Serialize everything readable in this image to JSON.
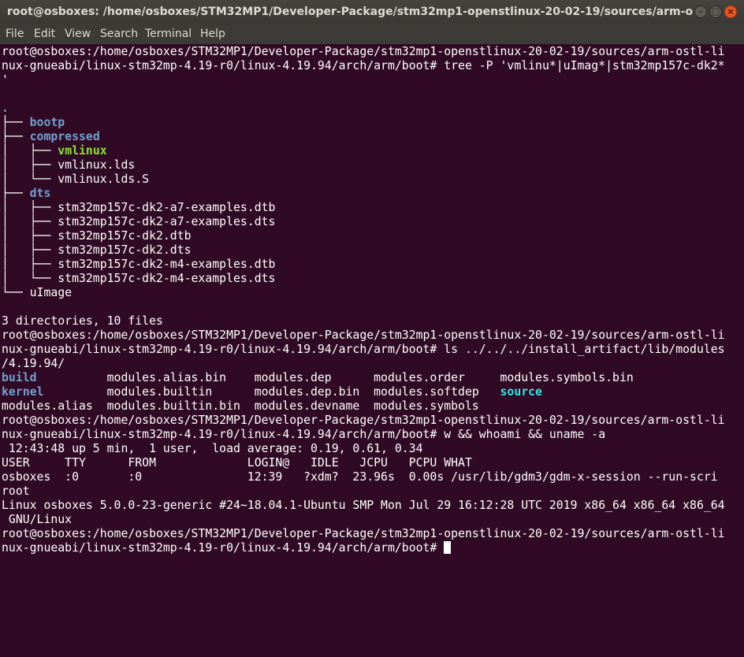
{
  "window": {
    "title": "root@osboxes: /home/osboxes/STM32MP1/Developer-Package/stm32mp1-openstlinux-20-02-19/sources/arm-ostl-linux-...",
    "buttons": {
      "minimize": "–",
      "maximize": "□",
      "close": "×"
    }
  },
  "menu": [
    "File",
    "Edit",
    "View",
    "Search",
    "Terminal",
    "Help"
  ],
  "terminal": {
    "lines": [
      [
        {
          "t": "root@osboxes:/home/osboxes/STM32MP1/Developer-Package/stm32mp1-openstlinux-20-02-19/sources/arm-ostl-li"
        }
      ],
      [
        {
          "t": "nux-gnueabi/linux-stm32mp-4.19-r0/linux-4.19.94/arch/arm/boot# tree -P 'vmlinu*|uImag*|stm32mp157c-dk2*"
        }
      ],
      [
        {
          "t": "'"
        }
      ],
      [
        {
          "t": "",
          "c": ""
        }
      ],
      [
        {
          "t": ".",
          "c": "blue"
        }
      ],
      [
        {
          "t": "├── "
        },
        {
          "t": "bootp",
          "c": "blue"
        }
      ],
      [
        {
          "t": "├── "
        },
        {
          "t": "compressed",
          "c": "blue"
        }
      ],
      [
        {
          "t": "│   ├── "
        },
        {
          "t": "vmlinux",
          "c": "green"
        }
      ],
      [
        {
          "t": "│   ├── vmlinux.lds"
        }
      ],
      [
        {
          "t": "│   └── vmlinux.lds.S"
        }
      ],
      [
        {
          "t": "├── "
        },
        {
          "t": "dts",
          "c": "blue"
        }
      ],
      [
        {
          "t": "│   ├── stm32mp157c-dk2-a7-examples.dtb"
        }
      ],
      [
        {
          "t": "│   ├── stm32mp157c-dk2-a7-examples.dts"
        }
      ],
      [
        {
          "t": "│   ├── stm32mp157c-dk2.dtb"
        }
      ],
      [
        {
          "t": "│   ├── stm32mp157c-dk2.dts"
        }
      ],
      [
        {
          "t": "│   ├── stm32mp157c-dk2-m4-examples.dtb"
        }
      ],
      [
        {
          "t": "│   └── stm32mp157c-dk2-m4-examples.dts"
        }
      ],
      [
        {
          "t": "└── uImage"
        }
      ],
      [
        {
          "t": ""
        }
      ],
      [
        {
          "t": "3 directories, 10 files"
        }
      ],
      [
        {
          "t": "root@osboxes:/home/osboxes/STM32MP1/Developer-Package/stm32mp1-openstlinux-20-02-19/sources/arm-ostl-li"
        }
      ],
      [
        {
          "t": "nux-gnueabi/linux-stm32mp-4.19-r0/linux-4.19.94/arch/arm/boot# ls ../../../install_artifact/lib/modules"
        }
      ],
      [
        {
          "t": "/4.19.94/"
        }
      ],
      [
        {
          "t": "build",
          "c": "blue"
        },
        {
          "t": "          modules.alias.bin    modules.dep      modules.order     modules.symbols.bin"
        }
      ],
      [
        {
          "t": "kernel",
          "c": "blue"
        },
        {
          "t": "         modules.builtin      modules.dep.bin  modules.softdep   "
        },
        {
          "t": "source",
          "c": "cyan"
        }
      ],
      [
        {
          "t": "modules.alias  modules.builtin.bin  modules.devname  modules.symbols"
        }
      ],
      [
        {
          "t": "root@osboxes:/home/osboxes/STM32MP1/Developer-Package/stm32mp1-openstlinux-20-02-19/sources/arm-ostl-li"
        }
      ],
      [
        {
          "t": "nux-gnueabi/linux-stm32mp-4.19-r0/linux-4.19.94/arch/arm/boot# w && whoami && uname -a"
        }
      ],
      [
        {
          "t": " 12:43:48 up 5 min,  1 user,  load average: 0.19, 0.61, 0.34"
        }
      ],
      [
        {
          "t": "USER     TTY      FROM             LOGIN@   IDLE   JCPU   PCPU WHAT"
        }
      ],
      [
        {
          "t": "osboxes  :0       :0               12:39   ?xdm?  23.96s  0.00s /usr/lib/gdm3/gdm-x-session --run-scri"
        }
      ],
      [
        {
          "t": "root"
        }
      ],
      [
        {
          "t": "Linux osboxes 5.0.0-23-generic #24~18.04.1-Ubuntu SMP Mon Jul 29 16:12:28 UTC 2019 x86_64 x86_64 x86_64"
        }
      ],
      [
        {
          "t": " GNU/Linux"
        }
      ],
      [
        {
          "t": "root@osboxes:/home/osboxes/STM32MP1/Developer-Package/stm32mp1-openstlinux-20-02-19/sources/arm-ostl-li"
        }
      ],
      [
        {
          "t": "nux-gnueabi/linux-stm32mp-4.19-r0/linux-4.19.94/arch/arm/boot# "
        },
        {
          "cursor": true
        }
      ]
    ]
  },
  "colors": {
    "background": "#300a24",
    "foreground": "#ffffff",
    "directory": "#729fcf",
    "executable": "#8ae234",
    "symlink": "#34e2e2",
    "close_button": "#e95420"
  }
}
